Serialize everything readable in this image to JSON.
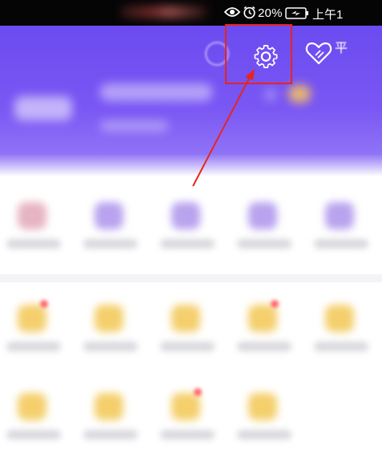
{
  "status_bar": {
    "battery_percent": "20%",
    "time": "上午1"
  },
  "header": {
    "side_label": "平"
  },
  "icons": {
    "eye": "eye-icon",
    "alarm": "alarm-icon",
    "battery": "battery-charging-icon",
    "more": "more-icon",
    "settings": "gear-icon",
    "favorite": "heart-icon"
  },
  "annotation": {
    "box_color": "#e8241c",
    "arrow_color": "#e8241c"
  },
  "colors": {
    "header_purple": "#6b4bf0",
    "icon_purple": "#b9a3ee",
    "icon_gold": "#f4cf6c"
  }
}
